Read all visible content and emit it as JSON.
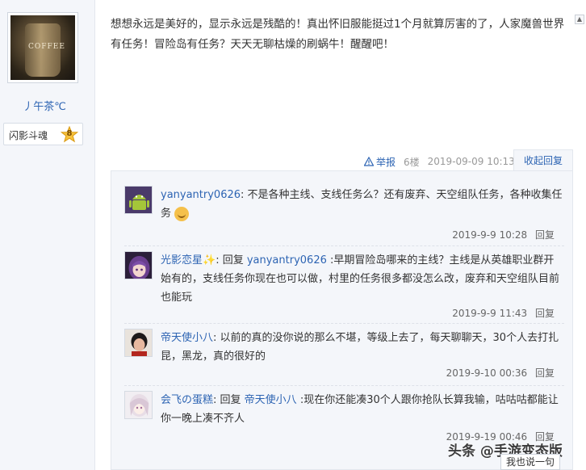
{
  "author": {
    "name": "丿午茶℃",
    "badge_label": "闪影斗魂",
    "badge_level": "8",
    "avatar_text": "COFFEE"
  },
  "post": {
    "text": "想想永远是美好的，显示永远是残酷的！真出怀旧服能挺过1个月就算厉害的了，人家魔兽世界有任务！冒险岛有任务？天天无聊枯燥的刷蜗牛！醒醒吧！",
    "report_label": "举报",
    "floor": "6楼",
    "time": "2019-09-09 10:13",
    "collapse_label": "收起回复"
  },
  "replies": [
    {
      "user": "yanyantry0626",
      "sep": ":",
      "reply_prefix": "",
      "reply_target": "",
      "text": " 不是各种主线、支线任务么？还有废弃、天空组队任务，各种收集任务",
      "time": "2019-9-9 10:28",
      "reply_label": "回复",
      "avatar": "android-avatar"
    },
    {
      "user": "光影恋星✨",
      "sep": ":",
      "reply_prefix": " 回复 ",
      "reply_target": "yanyantry0626",
      "text": " :早期冒险岛哪来的主线？主线是从英雄职业群开始有的，支线任务你现在也可以做，村里的任务很多都没怎么改，废弃和天空组队目前也能玩",
      "time": "2019-9-9 11:43",
      "reply_label": "回复",
      "avatar": "anime-purple-avatar"
    },
    {
      "user": "帝天使小八",
      "sep": ":",
      "reply_prefix": "",
      "reply_target": "",
      "text": " 以前的真的没你说的那么不堪，等级上去了，每天聊聊天，30个人去打扎昆，黑龙，真的很好的",
      "time": "2019-9-10 00:36",
      "reply_label": "回复",
      "avatar": "person-avatar"
    },
    {
      "user": "会飞の蛋糕",
      "sep": ":",
      "reply_prefix": " 回复 ",
      "reply_target": "帝天使小八",
      "text": " :现在你还能凑30个人跟你抢队长算我输，咕咕咕都能让你一晚上凑不齐人",
      "time": "2019-9-19 00:46",
      "reply_label": "回复",
      "avatar": "anime-girl-avatar"
    }
  ],
  "footer": {
    "say_button": "我也说一句",
    "watermark": "头条 @手游变态版"
  }
}
